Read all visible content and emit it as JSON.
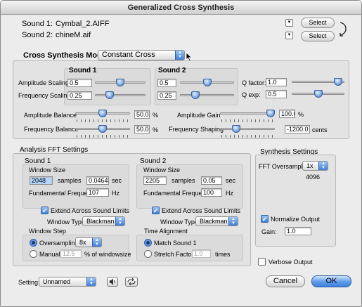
{
  "window": {
    "title": "Generalized Cross Synthesis"
  },
  "sounds": {
    "sound1_label": "Sound 1:",
    "sound1_file": "Cymbal_2.AIFF",
    "sound2_label": "Sound 2:",
    "sound2_file": "chineM.aif",
    "select_label": "Select"
  },
  "mode": {
    "label": "Cross Synthesis Mode:",
    "value": "Constant Cross"
  },
  "cross": {
    "sound1_heading": "Sound 1",
    "sound2_heading": "Sound 2",
    "amp_scaling_label": "Amplitude Scaling",
    "amp_scaling_1": "0.5",
    "amp_scaling_2": "0.5",
    "freq_scaling_label": "Frequency Scaling",
    "freq_scaling_1": "0.25",
    "freq_scaling_2": "0.25",
    "q_factor_label": "Q factor:",
    "q_factor": "1.0",
    "q_exp_label": "Q exp:",
    "q_exp": "0.5",
    "amp_balance_label": "Amplitude Balance",
    "amp_balance": "50.0",
    "amp_balance_unit": "%",
    "freq_balance_label": "Frequency Balance",
    "freq_balance": "50.0",
    "freq_balance_unit": "%",
    "amp_gain_label": "Amplitude Gain",
    "amp_gain": "100.0",
    "amp_gain_unit": "%",
    "freq_shaping_label": "Frequency Shaping",
    "freq_shaping": "-1200.0",
    "freq_shaping_unit": "cents"
  },
  "fft": {
    "heading": "Analysis FFT Settings",
    "s1": {
      "heading": "Sound 1",
      "window_size_label": "Window Size",
      "samples": "2048",
      "samples_unit": "samples",
      "seconds": "0.04644",
      "sec_unit": "sec",
      "fund_label": "Fundamental Frequency",
      "fund": "107",
      "hz": "Hz",
      "extend_label": "Extend Across Sound Limits",
      "wtype_label": "Window Type",
      "wtype": "Blackman",
      "step_heading": "Window Step",
      "oversampling_label": "Oversampling",
      "oversampling": "8x",
      "manual_label": "Manual",
      "manual_value": "12.5",
      "manual_unit": "% of windowsize"
    },
    "s2": {
      "heading": "Sound 2",
      "window_size_label": "Window Size",
      "samples": "2205",
      "samples_unit": "samples",
      "seconds": "0.05",
      "sec_unit": "sec",
      "fund_label": "Fundamental Frequency",
      "fund": "100",
      "hz": "Hz",
      "extend_label": "Extend Across Sound Limits",
      "wtype_label": "Window Type",
      "wtype": "Blackman",
      "align_heading": "Time Alignment",
      "match_label": "Match Sound 1",
      "stretch_label": "Stretch Factor",
      "stretch_value": "1.0",
      "times_unit": "times"
    }
  },
  "synthesis": {
    "heading": "Synthesis Settings",
    "fft_os_label": "FFT Oversampling",
    "fft_os": "1x",
    "fft_size": "4096",
    "normalize_label": "Normalize Output",
    "gain_label": "Gain:",
    "gain": "1.0"
  },
  "footer": {
    "verbose_label": "Verbose Output",
    "setting_label": "Setting:",
    "setting_value": "Unnamed",
    "cancel": "Cancel",
    "ok": "OK"
  },
  "sliders": {
    "amp_scaling_1": 0.5,
    "amp_scaling_2": 0.5,
    "freq_scaling_1": 0.25,
    "freq_scaling_2": 0.25,
    "q_factor": 0.95,
    "q_exp": 0.5,
    "amp_balance": 0.5,
    "freq_balance": 0.5,
    "amp_gain": 1.0,
    "freq_shaping": 0.25
  }
}
